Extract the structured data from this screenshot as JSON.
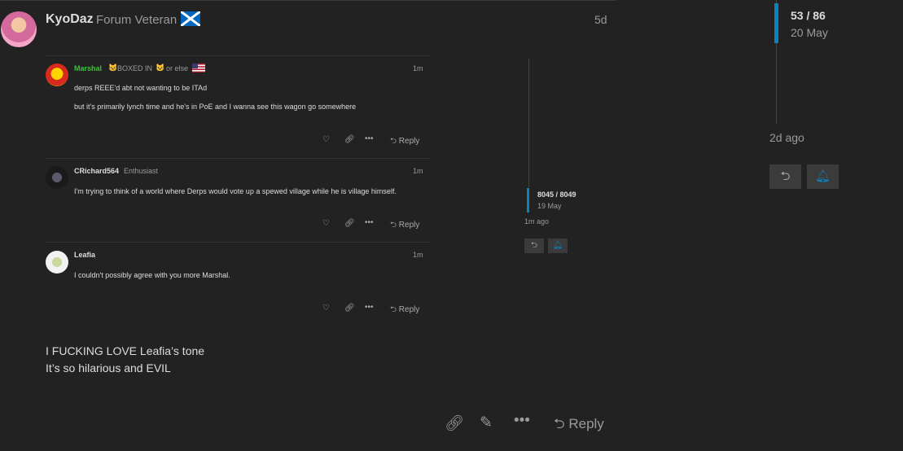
{
  "main_post": {
    "username": "KyoDaz",
    "title": "Forum Veteran",
    "date": "5d",
    "body_lines": [
      "I FUCKING LOVE Leafia’s tone",
      "It’s so hilarious and EVIL"
    ],
    "reply_label": "Reply"
  },
  "embedded_replies": [
    {
      "username": "Marshal",
      "flair": "BOXED IN",
      "flair_suffix": "or else",
      "date": "1m",
      "lines": [
        "derps REEE'd abt not wanting to be ITAd",
        "but it's primarily lynch time and he's in PoE and I wanna see this wagon go somewhere"
      ],
      "reply_label": "Reply"
    },
    {
      "username": "CRichard564",
      "title": "Enthusiast",
      "date": "1m",
      "lines": [
        "I'm trying to think of a world where Derps would vote up a spewed village while he is village himself."
      ],
      "reply_label": "Reply"
    },
    {
      "username": "Leafia",
      "date": "1m",
      "lines": [
        "I couldn't possibly agree with you more Marshal."
      ],
      "reply_label": "Reply"
    }
  ],
  "embedded_timeline": {
    "count": "8045 / 8049",
    "date": "19 May",
    "ago": "1m ago"
  },
  "timeline": {
    "count": "53 / 86",
    "date": "20 May",
    "ago": "2d ago"
  },
  "icons": {
    "like": "heart-icon",
    "link": "link-icon",
    "more": "ellipsis-icon",
    "reply": "reply-arrow-icon",
    "edit": "pencil-icon",
    "notify": "bell-icon"
  },
  "colors": {
    "background": "#222222",
    "accent": "#0a83bf",
    "marshal_name": "#3ac43a",
    "muted": "#9a9a9a"
  }
}
